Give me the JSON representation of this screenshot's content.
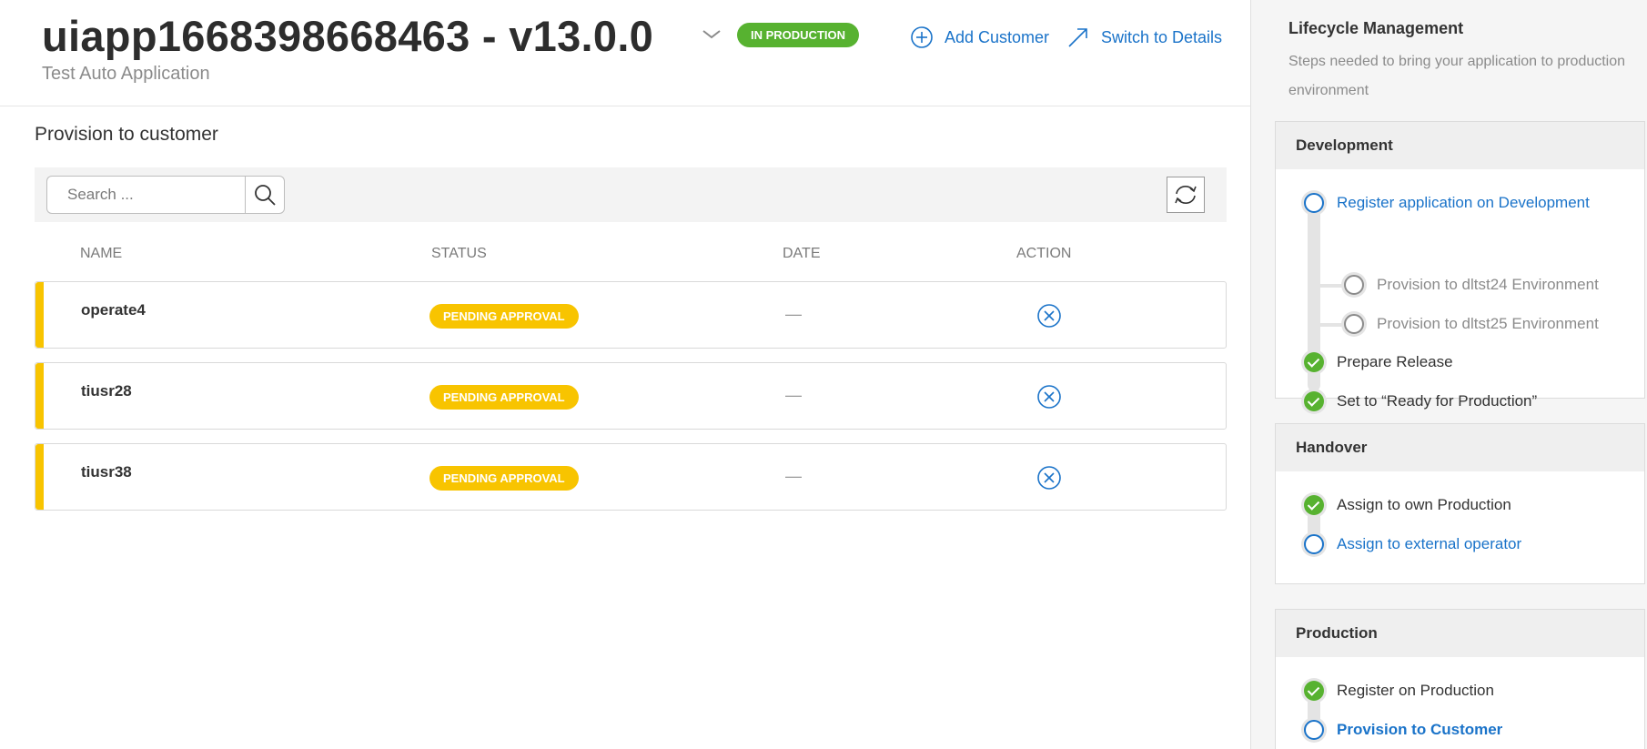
{
  "header": {
    "app_name": "uiapp1668398668463 - v13.0.0",
    "subtitle": "Test Auto Application",
    "status_badge": "IN PRODUCTION",
    "status_color": "#57b230",
    "add_customer_label": "Add Customer",
    "switch_details_label": "Switch to Details"
  },
  "main": {
    "section_title": "Provision to customer",
    "search": {
      "placeholder": "Search ...",
      "value": ""
    },
    "columns": {
      "name": "NAME",
      "status": "STATUS",
      "date": "DATE",
      "action": "ACTION"
    },
    "rows": [
      {
        "name": "operate4",
        "status": "PENDING APPROVAL",
        "date": "—"
      },
      {
        "name": "tiusr28",
        "status": "PENDING APPROVAL",
        "date": "—"
      },
      {
        "name": "tiusr38",
        "status": "PENDING APPROVAL",
        "date": "—"
      }
    ],
    "pending_color": "#f8c400"
  },
  "lifecycle": {
    "title": "Lifecycle Management",
    "description": "Steps needed to bring your application to production environment",
    "development": {
      "heading": "Development",
      "register": "Register application on Development",
      "provision_1": "Provision to dltst24 Environment",
      "provision_2": "Provision to dltst25 Environment",
      "prepare": "Prepare Release",
      "ready": "Set to “Ready for Production”"
    },
    "handover": {
      "heading": "Handover",
      "own": "Assign to own Production",
      "external": "Assign to external operator"
    },
    "production": {
      "heading": "Production",
      "register": "Register on Production",
      "provision": "Provision to Customer"
    }
  }
}
